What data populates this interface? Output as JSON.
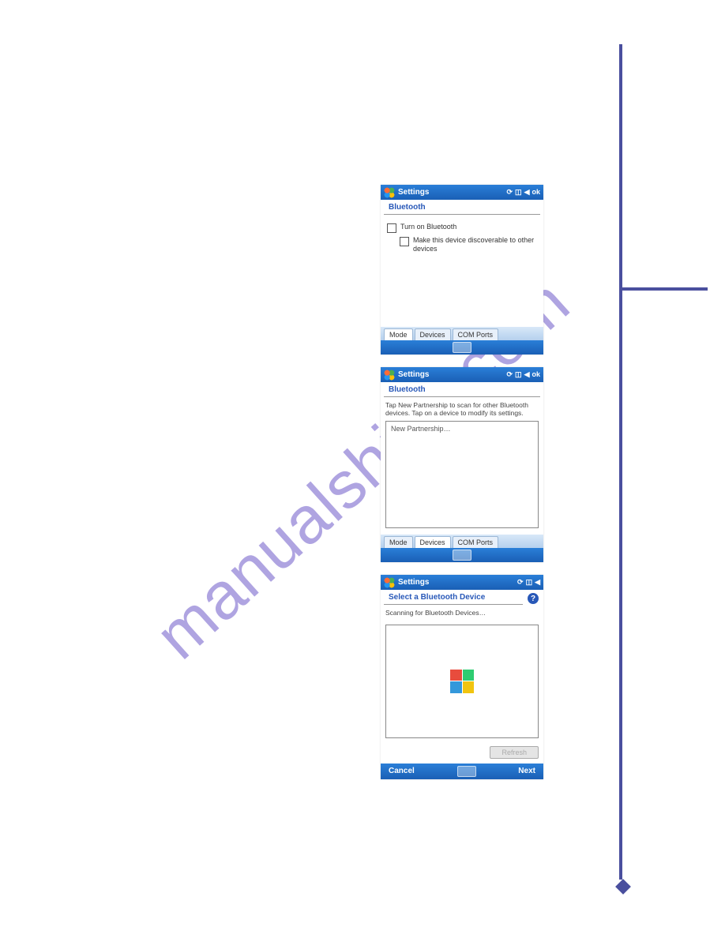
{
  "watermark": "manualshive.com",
  "screen1": {
    "titlebar": "Settings",
    "status_sync": "⟳",
    "status_conn": "◫",
    "status_vol": "◀",
    "status_ok": "ok",
    "section_title": "Bluetooth",
    "check1_label": "Turn on Bluetooth",
    "check2_label": "Make this device discoverable to other devices",
    "tabs": {
      "mode": "Mode",
      "devices": "Devices",
      "com": "COM Ports"
    }
  },
  "screen2": {
    "titlebar": "Settings",
    "status_sync": "⟳",
    "status_conn": "◫",
    "status_vol": "◀",
    "status_ok": "ok",
    "section_title": "Bluetooth",
    "instruction": "Tap New Partnership to scan for other Bluetooth devices. Tap on a device to modify its settings.",
    "new_partnership": "New Partnership…",
    "tabs": {
      "mode": "Mode",
      "devices": "Devices",
      "com": "COM Ports"
    }
  },
  "screen3": {
    "titlebar": "Settings",
    "status_sync": "⟳",
    "status_conn": "◫",
    "status_vol": "◀",
    "section_title": "Select a Bluetooth Device",
    "help": "?",
    "scanning": "Scanning for Bluetooth Devices…",
    "refresh": "Refresh",
    "cancel": "Cancel",
    "next": "Next"
  }
}
